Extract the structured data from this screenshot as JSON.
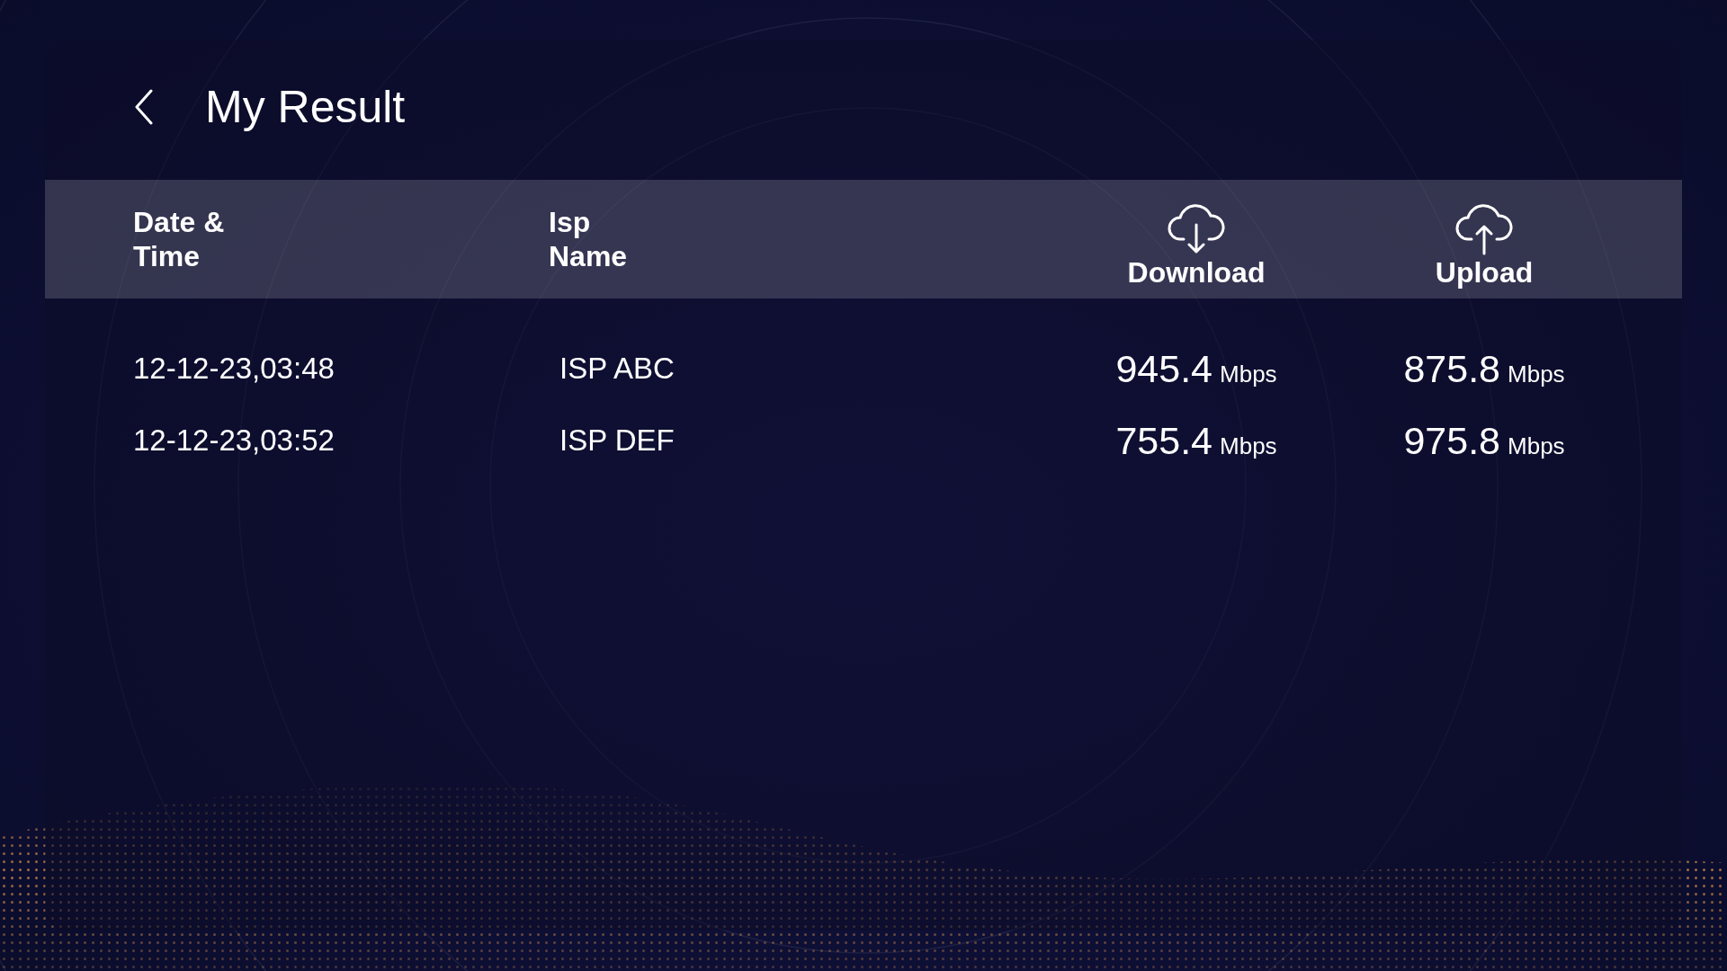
{
  "header": {
    "title": "My Result"
  },
  "table": {
    "columns": [
      {
        "label": "Date & Time",
        "kind": "text"
      },
      {
        "label": "Isp Name",
        "kind": "text"
      },
      {
        "label": "Download",
        "kind": "download"
      },
      {
        "label": "Upload",
        "kind": "upload"
      }
    ],
    "rows": [
      {
        "date_time": "12-12-23,03:48",
        "isp_name": "ISP ABC",
        "download": {
          "value": "945.4",
          "unit": "Mbps"
        },
        "upload": {
          "value": "875.8",
          "unit": "Mbps"
        }
      },
      {
        "date_time": "12-12-23,03:52",
        "isp_name": "ISP DEF",
        "download": {
          "value": "755.4",
          "unit": "Mbps"
        },
        "upload": {
          "value": "975.8",
          "unit": "Mbps"
        }
      }
    ]
  }
}
